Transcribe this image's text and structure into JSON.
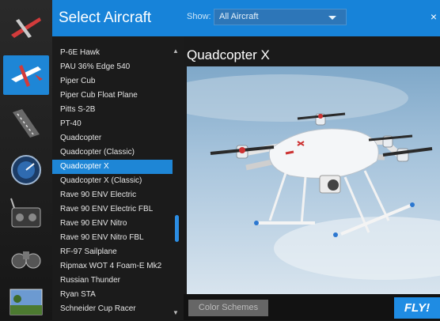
{
  "header": {
    "title": "Select Aircraft",
    "show_label": "Show:",
    "show_value": "All Aircraft",
    "close_symbol": "×"
  },
  "sidebar": {
    "icons": [
      {
        "name": "aircraft-category-icon"
      },
      {
        "name": "select-aircraft-icon",
        "active": true
      },
      {
        "name": "airfield-icon"
      },
      {
        "name": "gauge-icon"
      },
      {
        "name": "controller-icon"
      },
      {
        "name": "binoculars-icon"
      },
      {
        "name": "scenery-icon"
      }
    ]
  },
  "aircraft_list": {
    "items": [
      "P-6E Hawk",
      "PAU 36% Edge 540",
      "Piper Cub",
      "Piper Cub Float Plane",
      "Pitts S-2B",
      "PT-40",
      "Quadcopter",
      "Quadcopter (Classic)",
      "Quadcopter X",
      "Quadcopter X (Classic)",
      "Rave 90 ENV Electric",
      "Rave 90 ENV Electric FBL",
      "Rave 90 ENV Nitro",
      "Rave 90 ENV Nitro FBL",
      "RF-97 Sailplane",
      "Ripmax WOT 4 Foam-E Mk2",
      "Russian Thunder",
      "Ryan STA",
      "Schneider Cup Racer"
    ],
    "selected": "Quadcopter X"
  },
  "preview": {
    "title": "Quadcopter X"
  },
  "footer": {
    "color_schemes_label": "Color Schemes",
    "fly_label": "FLY!"
  },
  "colors": {
    "accent": "#1e86d6"
  }
}
